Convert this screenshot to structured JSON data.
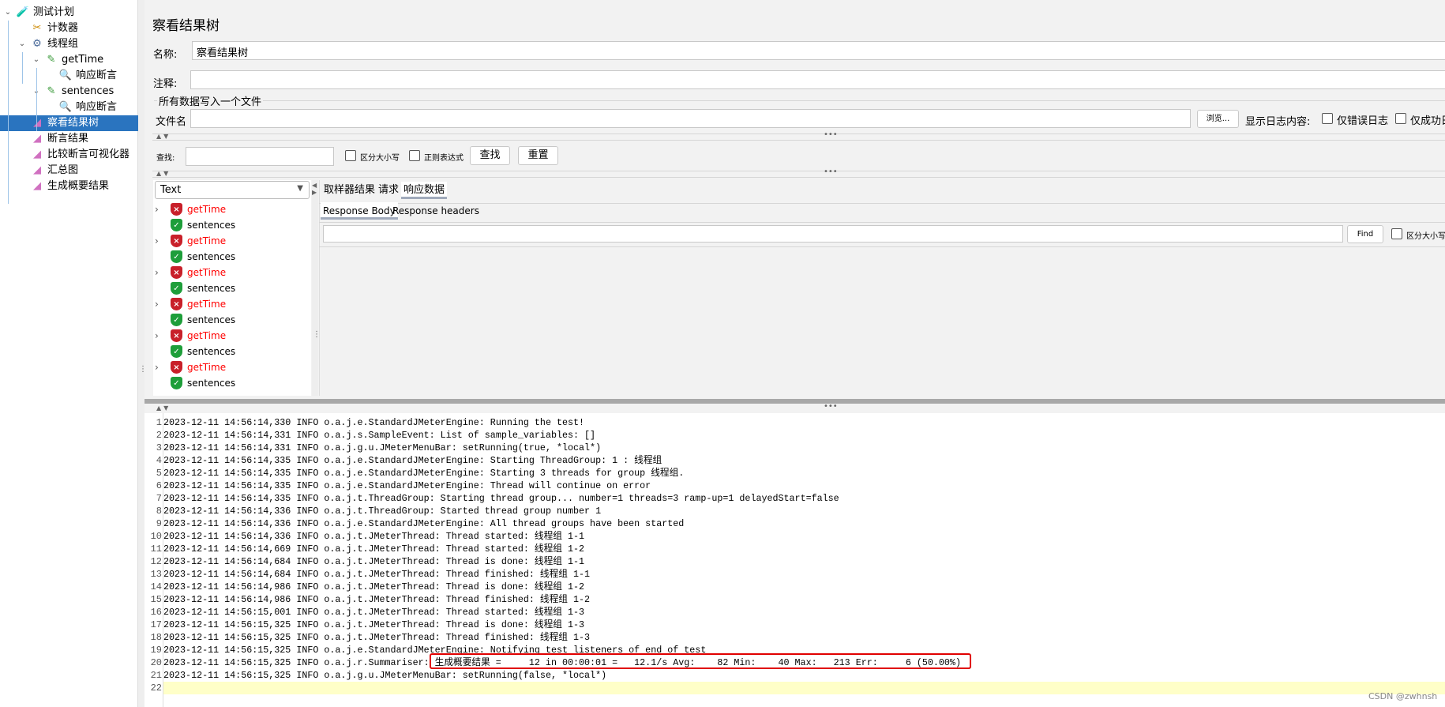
{
  "tree": [
    {
      "label": "测试计划",
      "icon": "test-plan-flask-icon"
    },
    {
      "label": "计数器",
      "icon": "tools-icon"
    },
    {
      "label": "线程组",
      "icon": "gear-icon"
    },
    {
      "label": "getTime",
      "icon": "sampler-pipette-icon"
    },
    {
      "label": "响应断言",
      "icon": "magnifier-icon"
    },
    {
      "label": "sentences",
      "icon": "sampler-pipette-icon"
    },
    {
      "label": "响应断言",
      "icon": "magnifier-icon"
    },
    {
      "label": "察看结果树",
      "icon": "listener-chart-icon",
      "selected": true
    },
    {
      "label": "断言结果",
      "icon": "listener-chart-icon"
    },
    {
      "label": "比较断言可视化器",
      "icon": "listener-chart-icon"
    },
    {
      "label": "汇总图",
      "icon": "listener-chart-icon"
    },
    {
      "label": "生成概要结果",
      "icon": "listener-chart-icon"
    }
  ],
  "panel": {
    "title": "察看结果树",
    "name_label": "名称:",
    "name_value": "察看结果树",
    "comment_label": "注释:",
    "comment_value": "",
    "file_group": "所有数据写入一个文件",
    "file_label": "文件名",
    "file_value": "",
    "browse": "浏览...",
    "log_content_label": "显示日志内容:",
    "errors_only": "仅错误日志",
    "success_only": "仅成功日志"
  },
  "search": {
    "label": "查找:",
    "value": "",
    "case": "区分大小写",
    "regex": "正则表达式",
    "find": "查找",
    "reset": "重置"
  },
  "renderer": {
    "selected": "Text"
  },
  "results": [
    {
      "label": "getTime",
      "status": "fail"
    },
    {
      "label": "sentences",
      "status": "pass"
    },
    {
      "label": "getTime",
      "status": "fail"
    },
    {
      "label": "sentences",
      "status": "pass"
    },
    {
      "label": "getTime",
      "status": "fail"
    },
    {
      "label": "sentences",
      "status": "pass"
    },
    {
      "label": "getTime",
      "status": "fail"
    },
    {
      "label": "sentences",
      "status": "pass"
    },
    {
      "label": "getTime",
      "status": "fail"
    },
    {
      "label": "sentences",
      "status": "pass"
    },
    {
      "label": "getTime",
      "status": "fail"
    },
    {
      "label": "sentences",
      "status": "pass"
    }
  ],
  "tabs": [
    "取样器结果",
    "请求",
    "响应数据"
  ],
  "subtabs": [
    "Response Body",
    "Response headers"
  ],
  "find_bar": {
    "value": "",
    "find": "Find",
    "case": "区分大小写"
  },
  "log": [
    "2023-12-11 14:56:14,330 INFO o.a.j.e.StandardJMeterEngine: Running the test!",
    "2023-12-11 14:56:14,331 INFO o.a.j.s.SampleEvent: List of sample_variables: []",
    "2023-12-11 14:56:14,331 INFO o.a.j.g.u.JMeterMenuBar: setRunning(true, *local*)",
    "2023-12-11 14:56:14,335 INFO o.a.j.e.StandardJMeterEngine: Starting ThreadGroup: 1 : 线程组",
    "2023-12-11 14:56:14,335 INFO o.a.j.e.StandardJMeterEngine: Starting 3 threads for group 线程组.",
    "2023-12-11 14:56:14,335 INFO o.a.j.e.StandardJMeterEngine: Thread will continue on error",
    "2023-12-11 14:56:14,335 INFO o.a.j.t.ThreadGroup: Starting thread group... number=1 threads=3 ramp-up=1 delayedStart=false",
    "2023-12-11 14:56:14,336 INFO o.a.j.t.ThreadGroup: Started thread group number 1",
    "2023-12-11 14:56:14,336 INFO o.a.j.e.StandardJMeterEngine: All thread groups have been started",
    "2023-12-11 14:56:14,336 INFO o.a.j.t.JMeterThread: Thread started: 线程组 1-1",
    "2023-12-11 14:56:14,669 INFO o.a.j.t.JMeterThread: Thread started: 线程组 1-2",
    "2023-12-11 14:56:14,684 INFO o.a.j.t.JMeterThread: Thread is done: 线程组 1-1",
    "2023-12-11 14:56:14,684 INFO o.a.j.t.JMeterThread: Thread finished: 线程组 1-1",
    "2023-12-11 14:56:14,986 INFO o.a.j.t.JMeterThread: Thread is done: 线程组 1-2",
    "2023-12-11 14:56:14,986 INFO o.a.j.t.JMeterThread: Thread finished: 线程组 1-2",
    "2023-12-11 14:56:15,001 INFO o.a.j.t.JMeterThread: Thread started: 线程组 1-3",
    "2023-12-11 14:56:15,325 INFO o.a.j.t.JMeterThread: Thread is done: 线程组 1-3",
    "2023-12-11 14:56:15,325 INFO o.a.j.t.JMeterThread: Thread finished: 线程组 1-3",
    "2023-12-11 14:56:15,325 INFO o.a.j.e.StandardJMeterEngine: Notifying test listeners of end of test",
    "2023-12-11 14:56:15,325 INFO o.a.j.r.Summariser: 生成概要结果 =     12 in 00:00:01 =   12.1/s Avg:    82 Min:    40 Max:   213 Err:     6 (50.00%)",
    "2023-12-11 14:56:15,325 INFO o.a.j.g.u.JMeterMenuBar: setRunning(false, *local*)",
    ""
  ],
  "watermark": "CSDN @zwhnsh",
  "colors": {
    "selection": "#2a74bf",
    "fail_text": "#ff0000",
    "highlight_line": "#ffffc8",
    "annotation_box": "#e00000"
  }
}
